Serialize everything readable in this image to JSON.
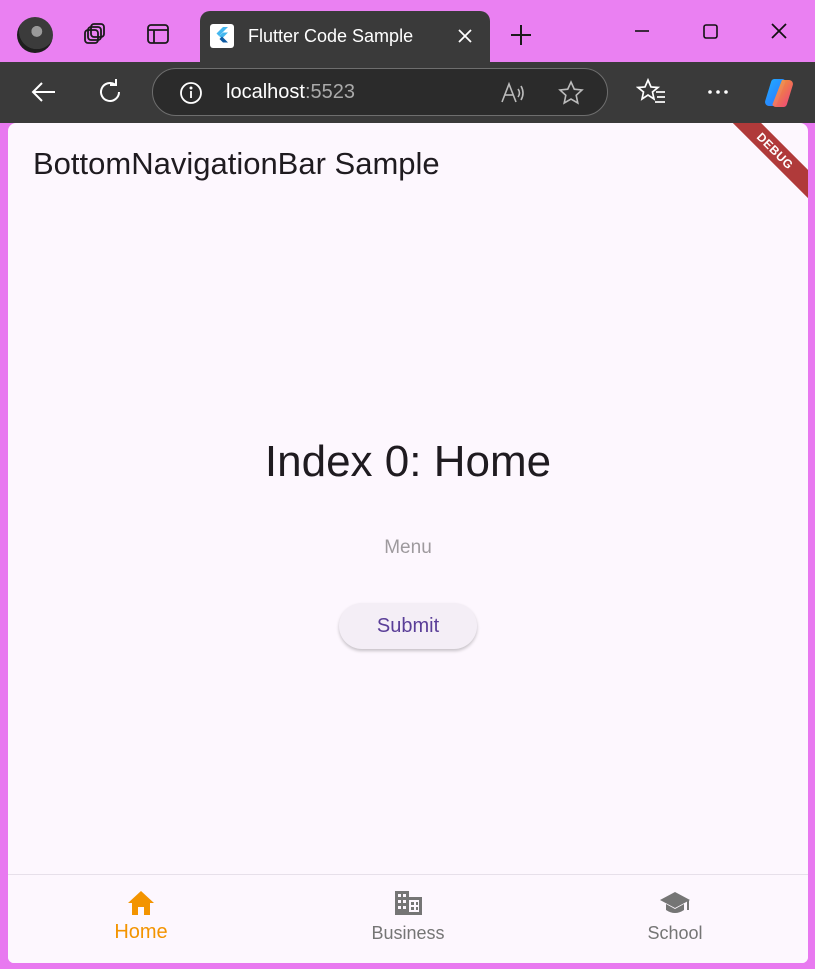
{
  "browser": {
    "tab": {
      "title": "Flutter Code Sample"
    },
    "address": {
      "host": "localhost",
      "port": ":5523"
    }
  },
  "app": {
    "appbar_title": "BottomNavigationBar Sample",
    "debug_banner": "DEBUG",
    "index_text": "Index 0: Home",
    "menu_text": "Menu",
    "submit_label": "Submit",
    "bottom_nav": {
      "selected_index": 0,
      "items": [
        {
          "label": "Home",
          "icon": "home-icon"
        },
        {
          "label": "Business",
          "icon": "business-icon"
        },
        {
          "label": "School",
          "icon": "school-icon"
        }
      ]
    }
  },
  "colors": {
    "active": "#f39400",
    "inactive": "#757575",
    "surface": "#fdf7fe",
    "titlebar": "#ea80f2",
    "debug": "#b03a3a"
  }
}
